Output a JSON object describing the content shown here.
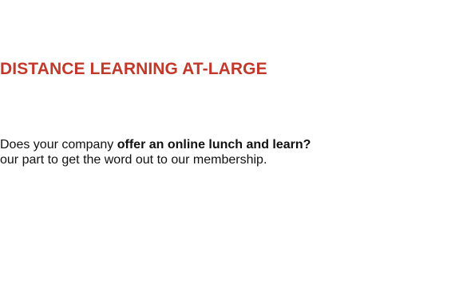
{
  "section": {
    "heading": "DISTANCE LEARNING AT-LARGE",
    "paragraph": {
      "line1_prefix": "Does your company ",
      "line1_emphasis": "offer an online lunch and learn?",
      "line2": "our part to get the word out to our membership."
    }
  },
  "colors": {
    "heading": "#c0392b",
    "body": "#111111",
    "background": "#ffffff"
  }
}
